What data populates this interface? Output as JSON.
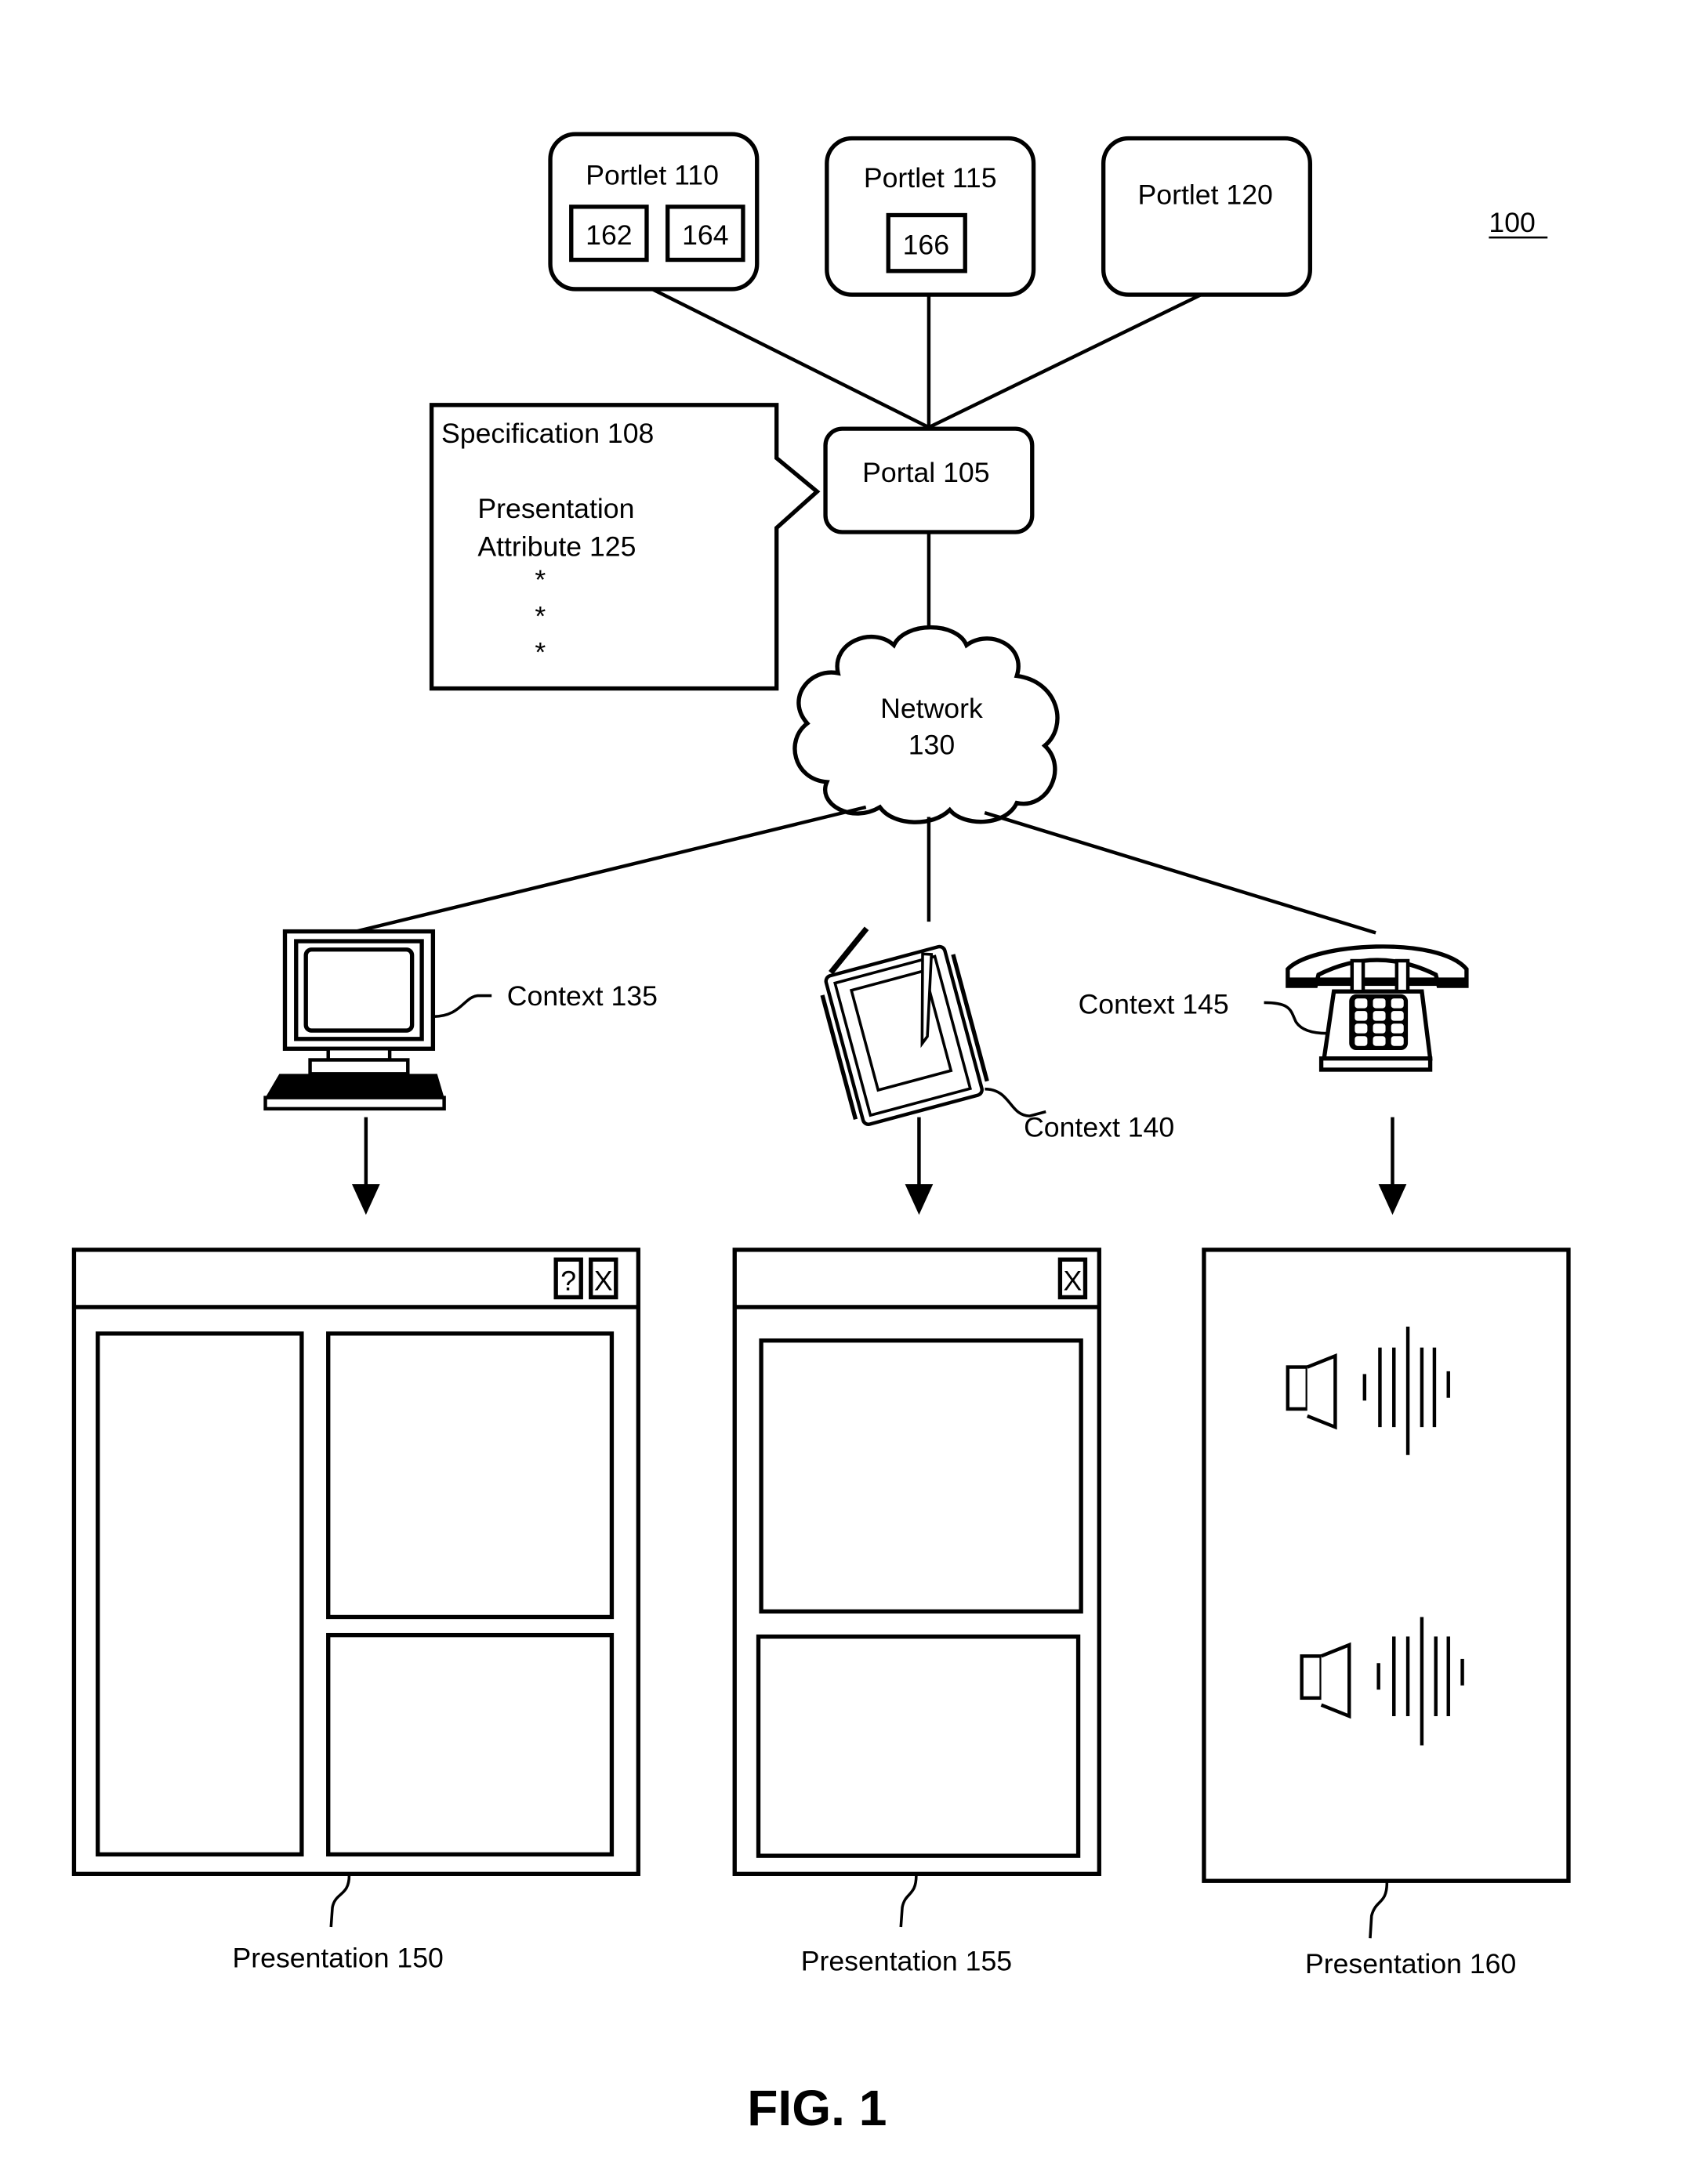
{
  "figure": {
    "reference": "100",
    "caption": "FIG. 1"
  },
  "portlets": [
    {
      "label": "Portlet 110",
      "components": [
        "162",
        "164"
      ]
    },
    {
      "label": "Portlet 115",
      "components": [
        "166"
      ]
    },
    {
      "label": "Portlet 120",
      "components": []
    }
  ],
  "portal": {
    "label": "Portal 105"
  },
  "specification": {
    "title": "Specification 108",
    "attribute_line1": "Presentation",
    "attribute_line2": "Attribute 125",
    "ellipsis": [
      "*",
      "*",
      "*"
    ]
  },
  "network": {
    "line1": "Network",
    "line2": "130"
  },
  "contexts": [
    {
      "label": "Context 135",
      "device": "desktop-computer"
    },
    {
      "label": "Context 140",
      "device": "pda"
    },
    {
      "label": "Context 145",
      "device": "telephone"
    }
  ],
  "presentations": [
    {
      "label": "Presentation 150",
      "title_buttons": [
        "?",
        "X"
      ]
    },
    {
      "label": "Presentation 155",
      "title_buttons": [
        "X"
      ]
    },
    {
      "label": "Presentation 160",
      "title_buttons": []
    }
  ]
}
